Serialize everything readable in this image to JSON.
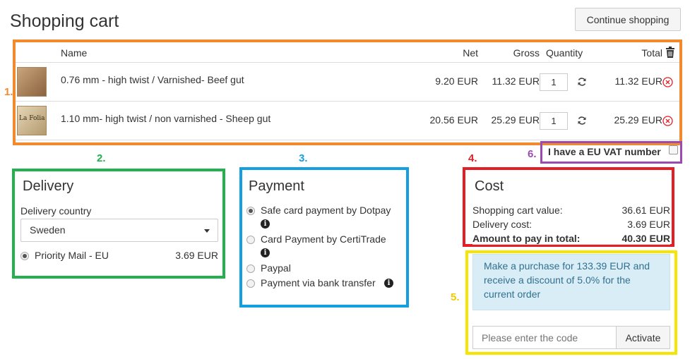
{
  "page": {
    "title": "Shopping cart",
    "continue_label": "Continue shopping"
  },
  "callouts": {
    "n1": "1.",
    "n2": "2.",
    "n3": "3.",
    "n4": "4.",
    "n5": "5.",
    "n6": "6."
  },
  "colors": {
    "orange": "#f08a2c",
    "green": "#22b14c",
    "blue": "#14a0e0",
    "red": "#e31e24",
    "purple": "#9b4bb0",
    "yellow": "#f5e500",
    "info_bg": "#d9edf7",
    "remove_red": "#e31e24"
  },
  "cart": {
    "columns": {
      "name": "Name",
      "net": "Net",
      "gross": "Gross",
      "quantity": "Quantity",
      "total": "Total"
    },
    "rows": [
      {
        "name": "0.76 mm - high twist / Varnished- Beef gut",
        "net": "9.20 EUR",
        "gross": "11.32 EUR",
        "qty": "1",
        "total": "11.32 EUR"
      },
      {
        "name": "1.10 mm- high twist / non varnished - Sheep gut",
        "net": "20.56 EUR",
        "gross": "25.29 EUR",
        "qty": "1",
        "total": "25.29 EUR",
        "thumb_text": "La Folia"
      }
    ]
  },
  "vat": {
    "label": "I have a EU VAT number"
  },
  "delivery": {
    "title": "Delivery",
    "country_label": "Delivery country",
    "country_value": "Sweden",
    "option": {
      "label": "Priority Mail - EU",
      "price": "3.69 EUR"
    }
  },
  "payment": {
    "title": "Payment",
    "options": [
      {
        "label": "Safe card payment by Dotpay",
        "selected": true
      },
      {
        "label": "Card Payment by CertiTrade",
        "selected": false
      },
      {
        "label": "Paypal",
        "selected": false
      },
      {
        "label": "Payment via bank transfer",
        "selected": false
      }
    ]
  },
  "cost": {
    "title": "Cost",
    "cart_value_label": "Shopping cart value:",
    "cart_value": "36.61 EUR",
    "delivery_label": "Delivery cost:",
    "delivery_value": "3.69 EUR",
    "total_label": "Amount to pay in total:",
    "total_value": "40.30 EUR"
  },
  "discount": {
    "message": "Make a purchase for 133.39 EUR and receive a discount of 5.0% for the current order",
    "code_placeholder": "Please enter the code",
    "activate_label": "Activate"
  }
}
